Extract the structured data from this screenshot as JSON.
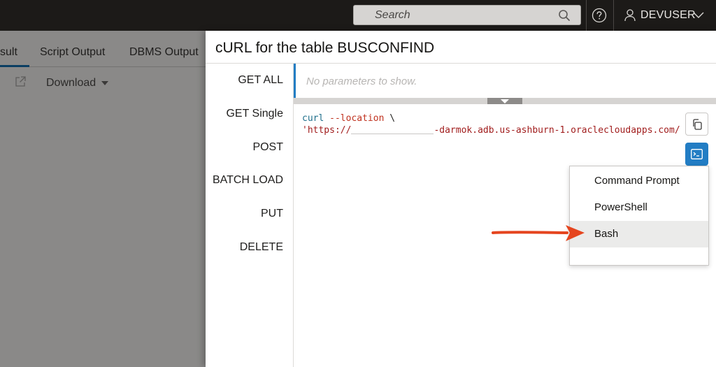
{
  "topbar": {
    "search_placeholder": "Search",
    "search_icon": "search-icon",
    "help_icon": "help-icon",
    "user_icon": "user-icon",
    "user_name": "DEVUSER"
  },
  "worksheet": {
    "tabs": [
      {
        "label": "sult",
        "active": true
      },
      {
        "label": "Script Output",
        "active": false
      },
      {
        "label": "DBMS Output",
        "active": false
      }
    ],
    "download_label": "Download"
  },
  "modal": {
    "title": "cURL for the table BUSCONFIND",
    "nav_items": [
      "GET ALL",
      "GET Single",
      "POST",
      "BATCH LOAD",
      "PUT",
      "DELETE"
    ],
    "selected_nav": "GET ALL",
    "params_placeholder": "No parameters to show.",
    "code": {
      "cmd": "curl",
      "option": "--location",
      "continuation": "\\",
      "url_prefix": "'https://",
      "url_suffix": "-darmok.adb.us-ashburn-1.oraclecloudapps.com/"
    },
    "copy_icon": "copy-icon",
    "terminal_icon": "terminal-icon",
    "shell_menu": {
      "items": [
        "Command Prompt",
        "PowerShell",
        "Bash"
      ],
      "highlighted": "Bash"
    }
  },
  "colors": {
    "accent": "#227dc4",
    "annotation_arrow": "#e5451f",
    "topbar": "#1c1a18"
  }
}
